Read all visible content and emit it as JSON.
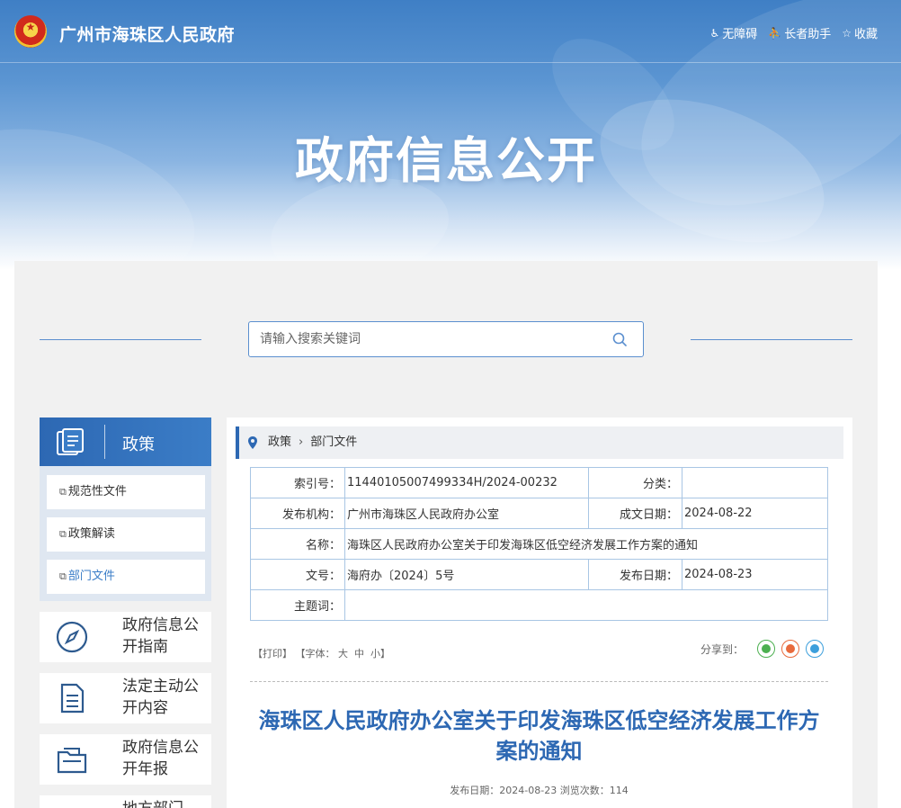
{
  "header": {
    "site_title": "广州市海珠区人民政府",
    "links": [
      {
        "label": "无障碍",
        "icon": "accessibility-icon"
      },
      {
        "label": "长者助手",
        "icon": "elder-helper-icon"
      },
      {
        "label": "收藏",
        "icon": "star-icon"
      }
    ],
    "banner_title": "政府信息公开"
  },
  "search": {
    "placeholder": "请输入搜索关键词"
  },
  "sidebar": {
    "head_label": "政策",
    "sub_items": [
      {
        "label": "规范性文件",
        "active": false
      },
      {
        "label": "政策解读",
        "active": false
      },
      {
        "label": "部门文件",
        "active": true
      }
    ],
    "cards": [
      {
        "label": "政府信息公开指南",
        "icon": "compass-icon"
      },
      {
        "label": "法定主动公开内容",
        "icon": "document-icon"
      },
      {
        "label": "政府信息公开年报",
        "icon": "folder-icon"
      },
      {
        "label": "地方部门",
        "icon": "building-icon"
      }
    ]
  },
  "breadcrumb": [
    "政策",
    "部门文件"
  ],
  "meta": {
    "index_label": "索引号：",
    "index_value": "11440105007499334H/2024-00232",
    "category_label": "分类：",
    "category_value": "",
    "publisher_label": "发布机构：",
    "publisher_value": "广州市海珠区人民政府办公室",
    "created_label": "成文日期：",
    "created_value": "2024-08-22",
    "name_label": "名称：",
    "name_value": "海珠区人民政府办公室关于印发海珠区低空经济发展工作方案的通知",
    "docno_label": "文号：",
    "docno_value": "海府办〔2024〕5号",
    "pubdate_label": "发布日期：",
    "pubdate_value": "2024-08-23",
    "keywords_label": "主题词：",
    "keywords_value": ""
  },
  "tools": {
    "print": "【打印】",
    "font_label": "【字体：",
    "font_big": "大",
    "font_mid": "中",
    "font_small": "小】",
    "share_label": "分享到："
  },
  "article": {
    "title": "海珠区人民政府办公室关于印发海珠区低空经济发展工作方案的通知",
    "meta": "发布日期：2024-08-23  浏览次数：114"
  },
  "colors": {
    "primary": "#2d68b3",
    "accent": "#3b7dc7",
    "border": "#a9c6e4"
  }
}
